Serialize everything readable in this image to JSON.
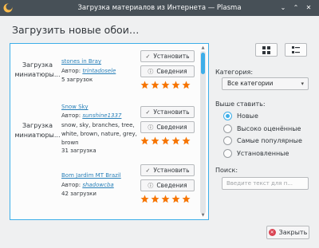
{
  "window": {
    "title": "Загрузка материалов из Интернета — Plasma"
  },
  "heading": "Загрузить новые обои…",
  "items": [
    {
      "thumb_label": "Загрузка миниатюры...",
      "title": "stones in Bray",
      "author_prefix": "Автор:",
      "author": "trintadosele",
      "description": "",
      "downloads": "5 загрузок",
      "install_label": "Установить",
      "details_label": "Сведения",
      "rating_stars": 5
    },
    {
      "thumb_label": "Загрузка миниатюры...",
      "title": "Snow Sky",
      "author_prefix": "Автор:",
      "author": "sunshine1337",
      "description": "snow, sky, branches, tree, white, brown, nature, grey, brown",
      "downloads": "31 загрузка",
      "install_label": "Установить",
      "details_label": "Сведения",
      "rating_stars": 5
    },
    {
      "thumb_label": "",
      "title": "Bom Jardim MT Brazil",
      "author_prefix": "Автор:",
      "author": "shadowcba",
      "description": "",
      "downloads": "42 загрузки",
      "install_label": "Установить",
      "details_label": "Сведения",
      "rating_stars": 5
    }
  ],
  "sidebar": {
    "category_label": "Категория:",
    "category_value": "Все категории",
    "sort_label": "Выше ставить:",
    "sort_options": [
      "Новые",
      "Высоко оценённые",
      "Самые популярные",
      "Установленные"
    ],
    "sort_selected": "Новые",
    "search_label": "Поиск:",
    "search_placeholder": "Введите текст для п...",
    "search_value": ""
  },
  "footer": {
    "close_label": "Закрыть"
  },
  "colors": {
    "accent": "#3daee9",
    "titlebar": "#475057",
    "star": "#f67400",
    "close_icon": "#da4453"
  }
}
